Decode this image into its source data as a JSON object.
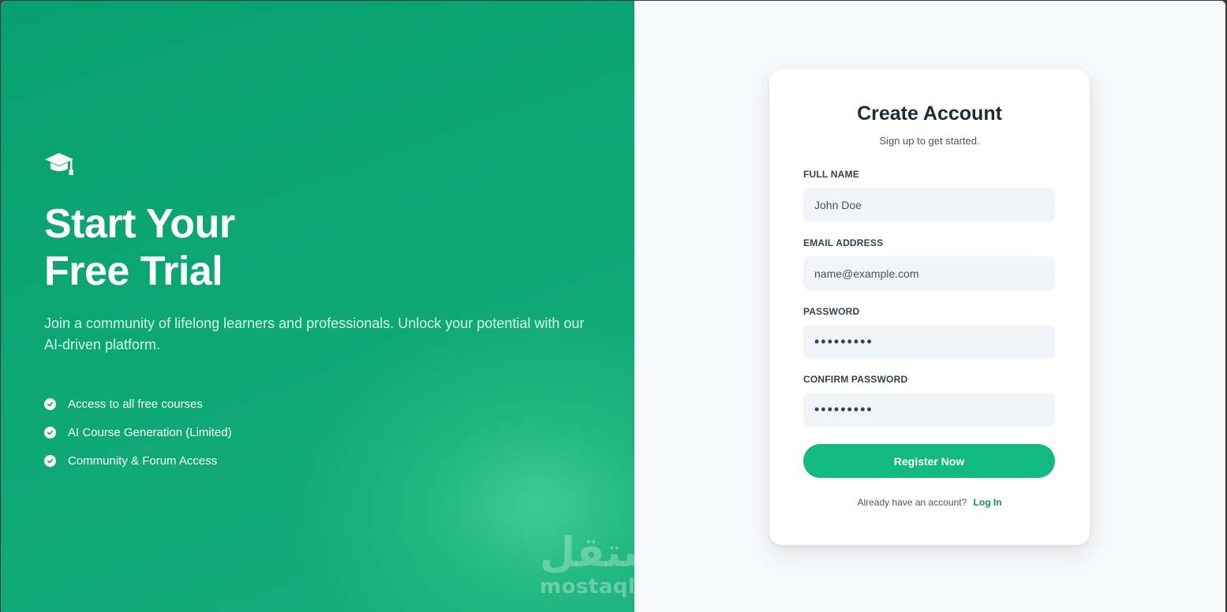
{
  "hero": {
    "logo_icon": "graduation-cap-icon",
    "title_line1": "Start Your",
    "title_line2": "Free Trial",
    "description": "Join a community of lifelong learners and professionals. Unlock your potential with our AI-driven platform.",
    "features": [
      {
        "icon": "check-circle-icon",
        "label": "Access to all free courses"
      },
      {
        "icon": "check-circle-icon",
        "label": "AI Course Generation (Limited)"
      },
      {
        "icon": "check-circle-icon",
        "label": "Community & Forum Access"
      }
    ]
  },
  "watermark": {
    "arabic": "مستقل",
    "latin": "mostaql.com"
  },
  "form": {
    "title": "Create Account",
    "subtitle": "Sign up to get started.",
    "full_name": {
      "label": "FULL NAME",
      "placeholder": "John Doe",
      "value": ""
    },
    "email": {
      "label": "EMAIL ADDRESS",
      "placeholder": "name@example.com",
      "value": ""
    },
    "password": {
      "label": "PASSWORD",
      "value": "password1"
    },
    "confirm_password": {
      "label": "CONFIRM PASSWORD",
      "value": "password1"
    },
    "submit_label": "Register Now",
    "login_prompt": "Already have an account?",
    "login_link": "Log In"
  },
  "colors": {
    "brand_green": "#12b981",
    "hero_green": "#0aa570",
    "link_green": "#0f8f63",
    "input_bg": "#f1f4f7"
  }
}
